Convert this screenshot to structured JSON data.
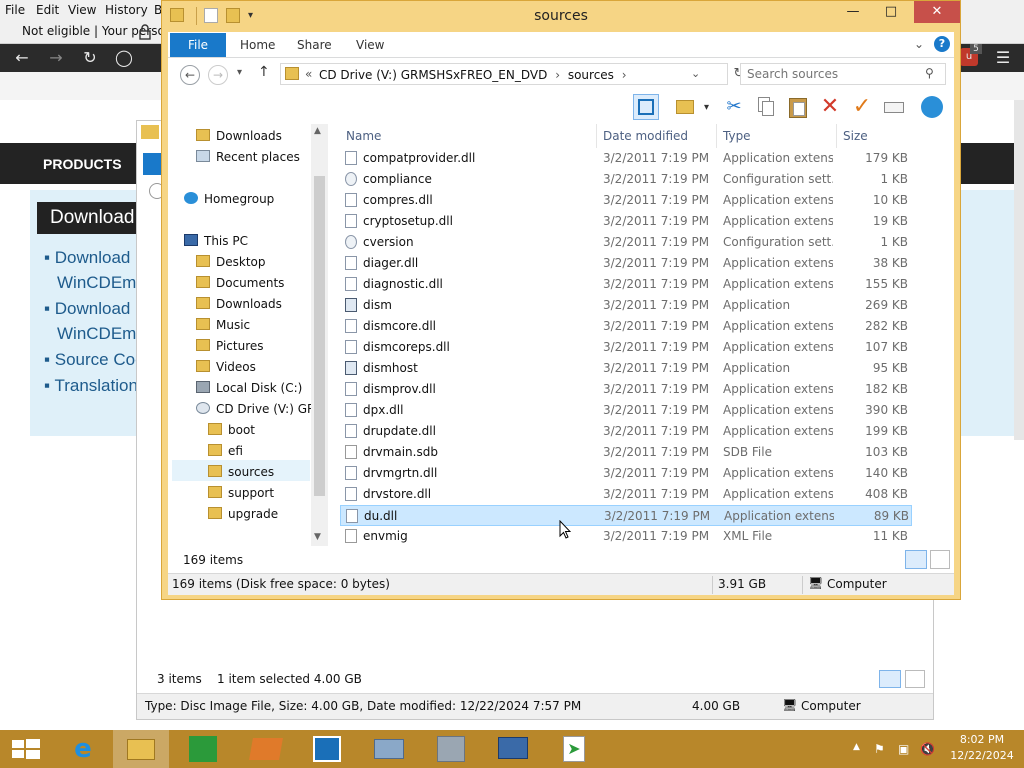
{
  "browser": {
    "menu": [
      "File",
      "Edit",
      "View",
      "History",
      "B"
    ],
    "tab_label": "Not eligible | Your persona",
    "products_label": "PRODUCTS",
    "download_heading": "Download",
    "list": [
      "Download",
      "WinCDEmu",
      "Download",
      "WinCDEmu",
      "Source Coo",
      "Translation"
    ],
    "badge": "5"
  },
  "behind_window": {
    "status_items": "3 items",
    "status_selected": "1 item selected  4.00 GB",
    "details": "Type: Disc Image File, Size: 4.00 GB, Date modified: 12/22/2024 7:57 PM",
    "size": "4.00 GB",
    "location": "Computer"
  },
  "window": {
    "title": "sources",
    "ribbon_tabs": [
      "File",
      "Home",
      "Share",
      "View"
    ],
    "address": {
      "prefix": "«",
      "drive": "CD Drive (V:) GRMSHSxFREO_EN_DVD",
      "folder": "sources"
    },
    "search_placeholder": "Search sources",
    "nav": [
      {
        "label": "Downloads",
        "icon": "download-folder-icon",
        "level": 1
      },
      {
        "label": "Recent places",
        "icon": "recent-places-icon",
        "level": 1
      },
      {
        "label": "Homegroup",
        "icon": "homegroup-icon",
        "level": 0
      },
      {
        "label": "This PC",
        "icon": "computer-icon",
        "level": 0
      },
      {
        "label": "Desktop",
        "icon": "folder-icon",
        "level": 1
      },
      {
        "label": "Documents",
        "icon": "folder-icon",
        "level": 1
      },
      {
        "label": "Downloads",
        "icon": "folder-icon",
        "level": 1
      },
      {
        "label": "Music",
        "icon": "folder-icon",
        "level": 1
      },
      {
        "label": "Pictures",
        "icon": "folder-icon",
        "level": 1
      },
      {
        "label": "Videos",
        "icon": "folder-icon",
        "level": 1
      },
      {
        "label": "Local Disk (C:)",
        "icon": "drive-icon",
        "level": 1
      },
      {
        "label": "CD Drive (V:) GRM",
        "icon": "cd-drive-icon",
        "level": 1
      },
      {
        "label": "boot",
        "icon": "folder-icon",
        "level": 2
      },
      {
        "label": "efi",
        "icon": "folder-icon",
        "level": 2
      },
      {
        "label": "sources",
        "icon": "folder-icon",
        "level": 2,
        "selected": true
      },
      {
        "label": "support",
        "icon": "folder-icon",
        "level": 2
      },
      {
        "label": "upgrade",
        "icon": "folder-icon",
        "level": 2
      }
    ],
    "columns": {
      "name": "Name",
      "date": "Date modified",
      "type": "Type",
      "size": "Size"
    },
    "files": [
      {
        "name": "compatprovider.dll",
        "date": "3/2/2011 7:19 PM",
        "type": "Application extens...",
        "size": "179 KB",
        "icon": "dll-icon"
      },
      {
        "name": "compliance",
        "date": "3/2/2011 7:19 PM",
        "type": "Configuration sett...",
        "size": "1 KB",
        "icon": "config-icon"
      },
      {
        "name": "compres.dll",
        "date": "3/2/2011 7:19 PM",
        "type": "Application extens...",
        "size": "10 KB",
        "icon": "dll-icon"
      },
      {
        "name": "cryptosetup.dll",
        "date": "3/2/2011 7:19 PM",
        "type": "Application extens...",
        "size": "19 KB",
        "icon": "dll-icon"
      },
      {
        "name": "cversion",
        "date": "3/2/2011 7:19 PM",
        "type": "Configuration sett...",
        "size": "1 KB",
        "icon": "config-icon"
      },
      {
        "name": "diager.dll",
        "date": "3/2/2011 7:19 PM",
        "type": "Application extens...",
        "size": "38 KB",
        "icon": "dll-icon"
      },
      {
        "name": "diagnostic.dll",
        "date": "3/2/2011 7:19 PM",
        "type": "Application extens...",
        "size": "155 KB",
        "icon": "dll-icon"
      },
      {
        "name": "dism",
        "date": "3/2/2011 7:19 PM",
        "type": "Application",
        "size": "269 KB",
        "icon": "application-icon"
      },
      {
        "name": "dismcore.dll",
        "date": "3/2/2011 7:19 PM",
        "type": "Application extens...",
        "size": "282 KB",
        "icon": "dll-icon"
      },
      {
        "name": "dismcoreps.dll",
        "date": "3/2/2011 7:19 PM",
        "type": "Application extens...",
        "size": "107 KB",
        "icon": "dll-icon"
      },
      {
        "name": "dismhost",
        "date": "3/2/2011 7:19 PM",
        "type": "Application",
        "size": "95 KB",
        "icon": "application-icon"
      },
      {
        "name": "dismprov.dll",
        "date": "3/2/2011 7:19 PM",
        "type": "Application extens...",
        "size": "182 KB",
        "icon": "dll-icon"
      },
      {
        "name": "dpx.dll",
        "date": "3/2/2011 7:19 PM",
        "type": "Application extens...",
        "size": "390 KB",
        "icon": "dll-icon"
      },
      {
        "name": "drupdate.dll",
        "date": "3/2/2011 7:19 PM",
        "type": "Application extens...",
        "size": "199 KB",
        "icon": "dll-icon"
      },
      {
        "name": "drvmain.sdb",
        "date": "3/2/2011 7:19 PM",
        "type": "SDB File",
        "size": "103 KB",
        "icon": "file-icon"
      },
      {
        "name": "drvmgrtn.dll",
        "date": "3/2/2011 7:19 PM",
        "type": "Application extens...",
        "size": "140 KB",
        "icon": "dll-icon"
      },
      {
        "name": "drvstore.dll",
        "date": "3/2/2011 7:19 PM",
        "type": "Application extens...",
        "size": "408 KB",
        "icon": "dll-icon"
      },
      {
        "name": "du.dll",
        "date": "3/2/2011 7:19 PM",
        "type": "Application extens...",
        "size": "89 KB",
        "icon": "dll-icon",
        "selected": true
      },
      {
        "name": "envmig",
        "date": "3/2/2011 7:19 PM",
        "type": "XML File",
        "size": "11 KB",
        "icon": "xml-file-icon"
      }
    ],
    "items_count": "169 items",
    "status_left": "169 items (Disk free space: 0 bytes)",
    "status_size": "3.91 GB",
    "status_location": "Computer"
  },
  "taskbar": {
    "apps": [
      "start-icon",
      "internet-explorer-icon",
      "file-explorer-icon",
      "store-icon",
      "app-icon",
      "app-icon",
      "app-icon",
      "app-icon",
      "app-icon",
      "app-icon"
    ],
    "time": "8:02 PM",
    "date": "12/22/2024"
  },
  "colors": {
    "accent": "#1979ca",
    "window_frame": "#f6d585",
    "taskbar": "#b8872a",
    "selection": "#cce8ff"
  }
}
